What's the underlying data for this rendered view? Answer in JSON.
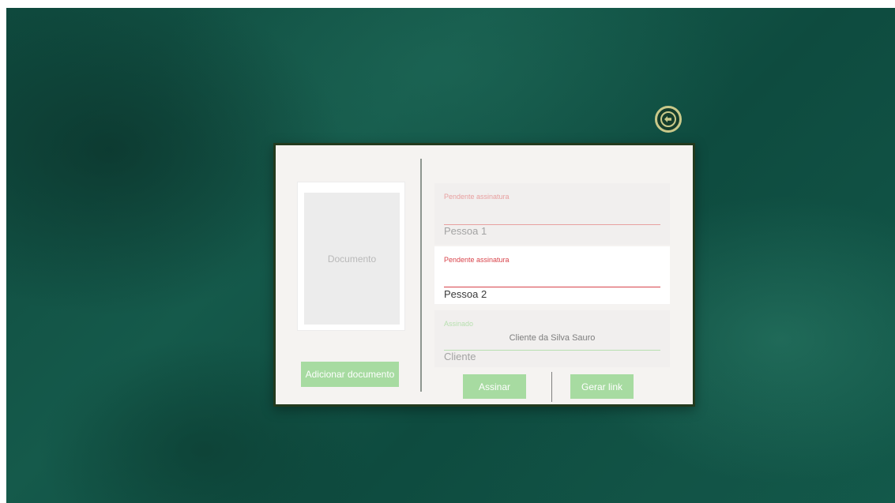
{
  "back_button": {
    "icon": "arrow-left-circle-icon",
    "ring_color": "#c9c98a"
  },
  "document_panel": {
    "preview_label": "Documento",
    "add_button_label": "Adicionar documento"
  },
  "signers": [
    {
      "status": "Pendente assinatura",
      "name": "Pessoa 1",
      "signed_name": "",
      "status_color": "#e8a0a0",
      "line_color": "#e8a0a0"
    },
    {
      "status": "Pendente assinatura",
      "name": "Pessoa 2",
      "signed_name": "",
      "status_color": "#d8434a",
      "line_color": "#d8434a"
    },
    {
      "status": "Assinado",
      "name": "Cliente",
      "signed_name": "Cliente da Silva Sauro",
      "status_color": "#b8e0b0",
      "line_color": "#b8e0b0"
    }
  ],
  "actions": {
    "sign_label": "Assinar",
    "link_label": "Gerar link"
  },
  "colors": {
    "button_green": "#a7dba1",
    "modal_bg": "#f5f3f1",
    "modal_border": "#233a1e",
    "page_bg": "#13594a"
  }
}
